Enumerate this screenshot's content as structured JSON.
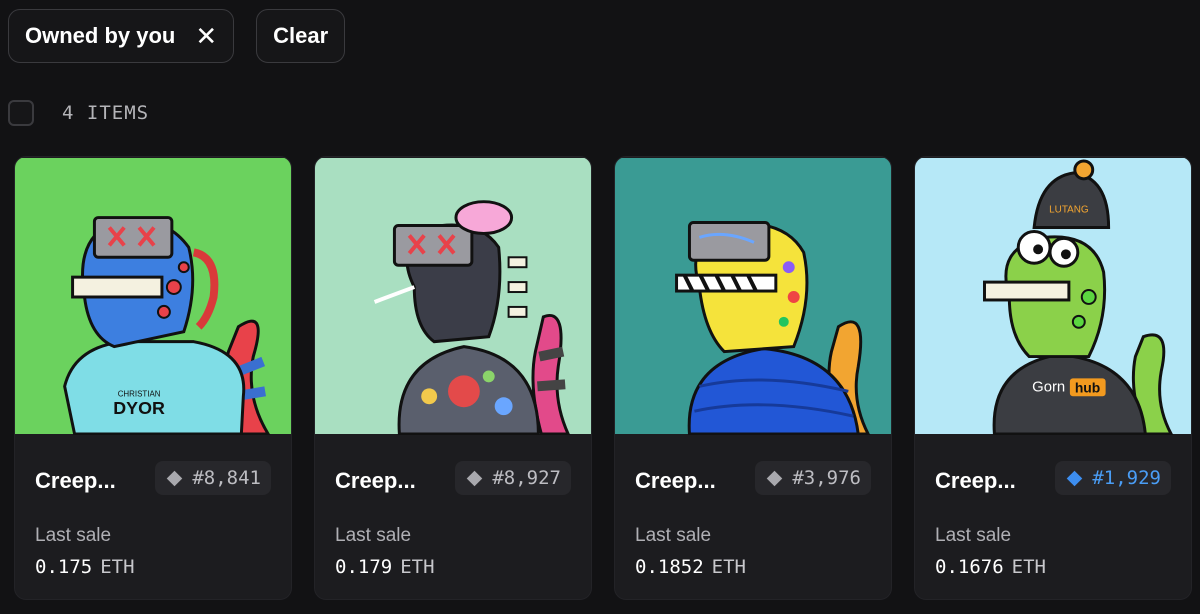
{
  "filters": {
    "owned_label": "Owned by you",
    "clear_label": "Clear"
  },
  "results": {
    "count_label": "4 ITEMS"
  },
  "colors": {
    "accent": "#3d8ef0",
    "background": "#121214",
    "card": "#1c1c1f"
  },
  "cards": [
    {
      "name": "Creep...",
      "id": "#8,841",
      "sale_label": "Last sale",
      "sale_value": "0.175",
      "unit": "ETH",
      "bg": "#6bd25e",
      "rarity_color": "gray"
    },
    {
      "name": "Creep...",
      "id": "#8,927",
      "sale_label": "Last sale",
      "sale_value": "0.179",
      "unit": "ETH",
      "bg": "#a9dfc1",
      "rarity_color": "gray"
    },
    {
      "name": "Creep...",
      "id": "#3,976",
      "sale_label": "Last sale",
      "sale_value": "0.1852",
      "unit": "ETH",
      "bg": "#3a9b94",
      "rarity_color": "gray"
    },
    {
      "name": "Creep...",
      "id": "#1,929",
      "sale_label": "Last sale",
      "sale_value": "0.1676",
      "unit": "ETH",
      "bg": "#b6e8f7",
      "rarity_color": "blue"
    }
  ],
  "art_text": {
    "hoodie_brand_small": "CHRISTIAN",
    "hoodie_brand_big": "DYOR",
    "beanie_text": "LUTANG",
    "shirt_text_left": "Gorn",
    "shirt_text_right": "hub"
  }
}
